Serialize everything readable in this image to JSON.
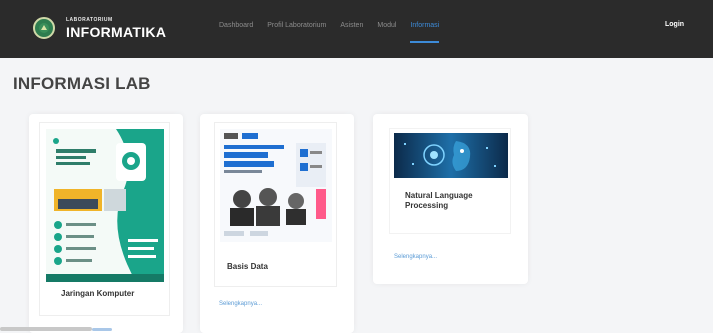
{
  "brand": {
    "subtitle": "LABORATORIUM",
    "title": "INFORMATIKA"
  },
  "nav": {
    "items": [
      {
        "label": "Dashboard"
      },
      {
        "label": "Profil Laboratorium"
      },
      {
        "label": "Asisten"
      },
      {
        "label": "Modul"
      },
      {
        "label": "Informasi"
      }
    ],
    "active_index": 4,
    "login_label": "Login"
  },
  "page": {
    "title": "INFORMASI LAB"
  },
  "cards": [
    {
      "title": "Jaringan Komputer",
      "link": "",
      "icon": "poster-jaringan-komputer"
    },
    {
      "title": "Basis Data",
      "link": "Selengkapnya...",
      "icon": "poster-basis-data"
    },
    {
      "title": "Natural Language Processing",
      "link": "Selengkapnya...",
      "icon": "poster-nlp"
    }
  ],
  "colors": {
    "navbar": "#2b2b2b",
    "accent": "#3d8bd8",
    "link": "#5b9bd5",
    "poster_green": "#1aa58a"
  }
}
